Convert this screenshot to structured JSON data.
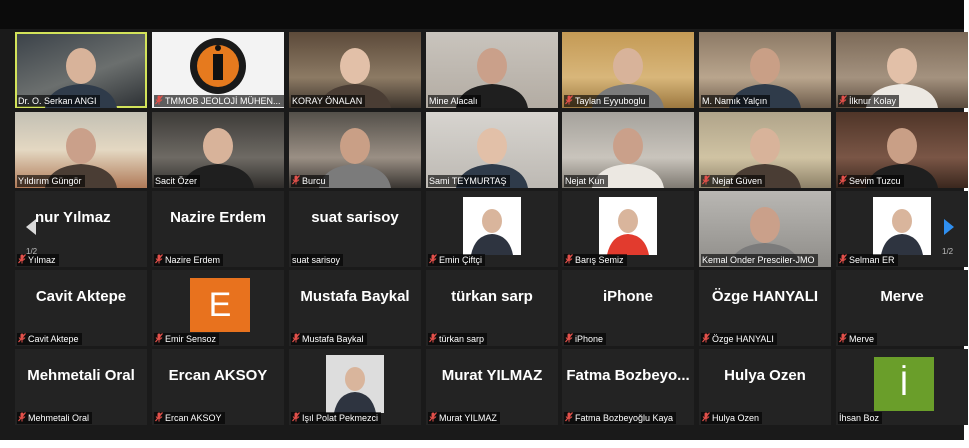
{
  "colors": {
    "tile_bg": "#232323",
    "active_outline": "#d3e35a",
    "mic_muted": "#e2504a",
    "nav_arrow": "#2f8ff0"
  },
  "pagination": {
    "left": "1/2",
    "right": "1/2"
  },
  "tiles": [
    {
      "name": "Dr. O. Serkan ANGI",
      "muted": false,
      "active": true,
      "kind": "video"
    },
    {
      "name": "TMMOB JEOLOJİ MÜHEN...",
      "muted": true,
      "kind": "logo"
    },
    {
      "name": "KORAY ÖNALAN",
      "muted": false,
      "kind": "video"
    },
    {
      "name": "Mine Alacalı",
      "muted": false,
      "kind": "video"
    },
    {
      "name": "Taylan Eyyuboglu",
      "muted": true,
      "kind": "video"
    },
    {
      "name": "M. Namık Yalçın",
      "muted": false,
      "kind": "video"
    },
    {
      "name": "İlknur Kolay",
      "muted": true,
      "kind": "video"
    },
    {
      "name": "Yıldırım Güngör",
      "muted": false,
      "kind": "video"
    },
    {
      "name": "Sacit Özer",
      "muted": false,
      "kind": "video"
    },
    {
      "name": "Burcu",
      "muted": true,
      "kind": "video"
    },
    {
      "name": "Sami TEYMURTAŞ",
      "muted": false,
      "kind": "video"
    },
    {
      "name": "Nejat Kun",
      "muted": false,
      "kind": "video"
    },
    {
      "name": "Nejat Güven",
      "muted": true,
      "kind": "video"
    },
    {
      "name": "Sevim Tuzcu",
      "muted": true,
      "kind": "video"
    },
    {
      "name": "Yılmaz",
      "display": "nur Yılmaz",
      "muted": true,
      "kind": "text"
    },
    {
      "name": "Nazire Erdem",
      "display": "Nazire Erdem",
      "muted": true,
      "kind": "text"
    },
    {
      "name": "suat sarisoy",
      "display": "suat sarisoy",
      "muted": false,
      "kind": "text"
    },
    {
      "name": "Emin Çiftçi",
      "muted": true,
      "kind": "pic"
    },
    {
      "name": "Barış Semiz",
      "muted": true,
      "kind": "pic"
    },
    {
      "name": "Kemal Onder Presciler-JMO",
      "muted": false,
      "kind": "video"
    },
    {
      "name": "Selman ER",
      "muted": true,
      "kind": "pic"
    },
    {
      "name": "Cavit Aktepe",
      "display": "Cavit Aktepe",
      "muted": true,
      "kind": "text"
    },
    {
      "name": "Emir Sensoz",
      "avatar": "E",
      "avatar_color": "#e8721e",
      "muted": true,
      "kind": "avatar"
    },
    {
      "name": "Mustafa Baykal",
      "display": "Mustafa Baykal",
      "muted": true,
      "kind": "text"
    },
    {
      "name": "türkan sarp",
      "display": "türkan sarp",
      "muted": true,
      "kind": "text"
    },
    {
      "name": "iPhone",
      "display": "iPhone",
      "muted": true,
      "kind": "text"
    },
    {
      "name": "Özge HANYALI",
      "display": "Özge HANYALI",
      "muted": true,
      "kind": "text"
    },
    {
      "name": "Merve",
      "display": "Merve",
      "muted": true,
      "kind": "text"
    },
    {
      "name": "Mehmetali Oral",
      "display": "Mehmetali Oral",
      "muted": true,
      "kind": "text"
    },
    {
      "name": "Ercan AKSOY",
      "display": "Ercan AKSOY",
      "muted": true,
      "kind": "text"
    },
    {
      "name": "Işıl Polat Pekmezci",
      "muted": true,
      "kind": "pic"
    },
    {
      "name": "Murat YILMAZ",
      "display": "Murat YILMAZ",
      "muted": true,
      "kind": "text"
    },
    {
      "name": "Fatma Bozbeyoğlu Kaya",
      "display": "Fatma  Bozbeyo...",
      "muted": true,
      "kind": "text"
    },
    {
      "name": "Hulya Ozen",
      "display": "Hulya Ozen",
      "muted": true,
      "kind": "text"
    },
    {
      "name": "İhsan Boz",
      "avatar": "İ",
      "avatar_color": "#6a9e2a",
      "muted": false,
      "kind": "avatar"
    }
  ]
}
